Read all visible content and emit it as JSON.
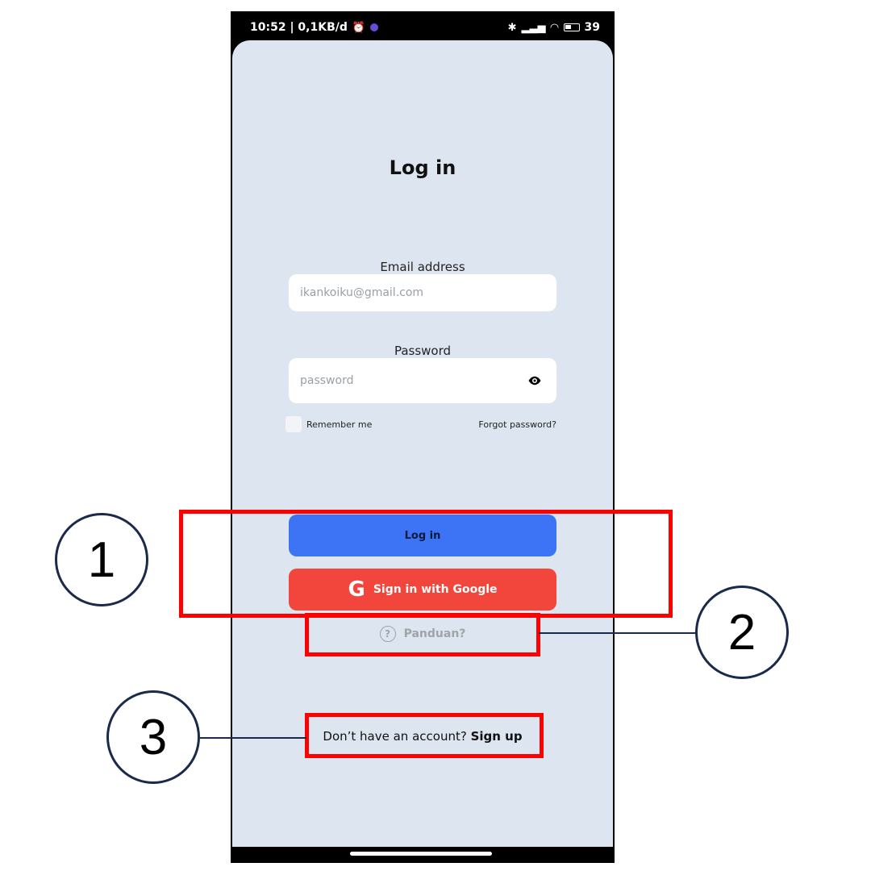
{
  "status_bar": {
    "time_info": "10:52 | 0,1KB/d",
    "battery": "39"
  },
  "login": {
    "title": "Log in",
    "email_label": "Email address",
    "email_placeholder": "ikankoiku@gmail.com",
    "password_label": "Password",
    "password_placeholder": "password",
    "remember_label": "Remember me",
    "forgot_label": "Forgot password?",
    "login_button": "Log in",
    "google_button": "Sign in with Google",
    "google_icon_glyph": "G",
    "help_label": "Panduan?",
    "help_icon_glyph": "?",
    "signup_prompt": "Don’t have an account?",
    "signup_link": "Sign up"
  },
  "annotations": {
    "callout_1": "1",
    "callout_2": "2",
    "callout_3": "3",
    "box_color": "#ff0000"
  },
  "colors": {
    "screen_bg": "#dde6f0",
    "login_button": "#3d74f6",
    "google_button": "#f2453c"
  }
}
